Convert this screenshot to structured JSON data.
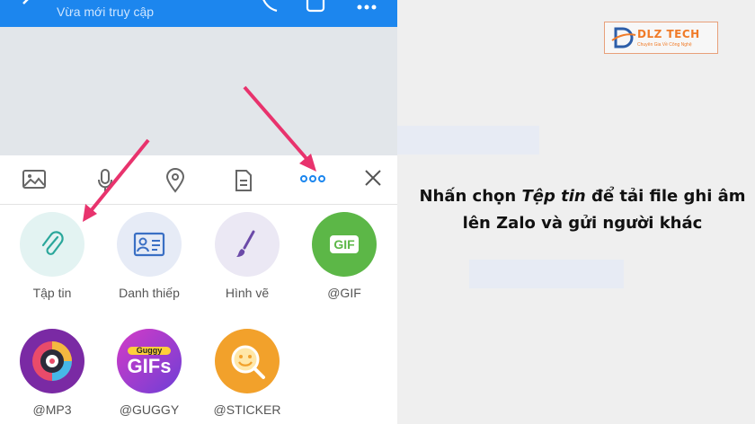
{
  "header": {
    "status": "Vừa mới truy cập"
  },
  "toolbar": {
    "icons": [
      "image-icon",
      "microphone-icon",
      "location-icon",
      "document-icon",
      "more-icon",
      "close-icon"
    ]
  },
  "grid": {
    "items": [
      {
        "label": "Tập tin",
        "icon": "paperclip-icon",
        "color": "#e3f3f2"
      },
      {
        "label": "Danh thiếp",
        "icon": "contact-card-icon",
        "color": "#e6ebf6"
      },
      {
        "label": "Hình vẽ",
        "icon": "brush-icon",
        "color": "#ebe8f4"
      },
      {
        "label": "@GIF",
        "icon": "gif-icon",
        "color": "#5cb747",
        "badge": "GIF"
      },
      {
        "label": "@MP3",
        "icon": "mp3-icon",
        "color": "#7a2aa4"
      },
      {
        "label": "@GUGGY",
        "icon": "guggy-icon",
        "color": "#b23bd0",
        "badge_top": "Guggy",
        "badge": "GIFs"
      },
      {
        "label": "@STICKER",
        "icon": "sticker-icon",
        "color": "#f2a12b"
      }
    ]
  },
  "caption": {
    "line1_before": "Nhấn chọn ",
    "line1_italic": "Tệp tin",
    "line1_after": " để tải file ghi âm",
    "line2": "lên Zalo và gửi người khác"
  },
  "logo": {
    "text": "DLZ TECH",
    "tagline": "Chuyên Gia Về Công Nghệ"
  },
  "colors": {
    "accent": "#1c86ee",
    "arrow": "#e8336d"
  }
}
